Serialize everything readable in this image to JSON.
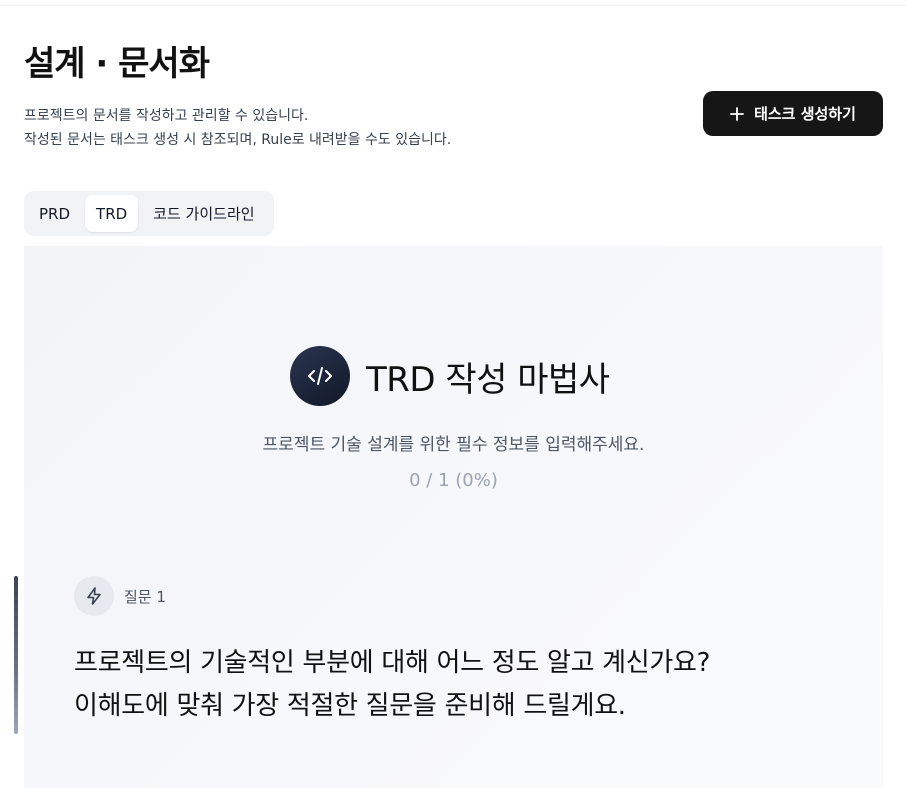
{
  "header": {
    "title": "설계 · 문서화",
    "description_line1": "프로젝트의 문서를 작성하고 관리할 수 있습니다.",
    "description_line2": "작성된 문서는 태스크 생성 시 참조되며, Rule로 내려받을 수도 있습니다.",
    "create_task_label": "태스크 생성하기"
  },
  "tabs": [
    {
      "label": "PRD",
      "active": false
    },
    {
      "label": "TRD",
      "active": true
    },
    {
      "label": "코드 가이드라인",
      "active": false
    }
  ],
  "wizard": {
    "title": "TRD 작성 마법사",
    "subtitle": "프로젝트 기술 설계를 위한 필수 정보를 입력해주세요.",
    "progress": "0 / 1 (0%)",
    "question_label": "질문 1",
    "question_line1": "프로젝트의 기술적인 부분에 대해 어느 정도 알고 계신가요?",
    "question_line2": "이해도에 맞춰 가장 적절한 질문을 준비해 드릴게요."
  },
  "icons": {
    "create_button": "plus-icon",
    "wizard_badge": "code-icon",
    "question_badge": "lightning-icon"
  },
  "colors": {
    "primary_button": "#161616",
    "badge": "#1a2233",
    "progress_text": "#9aa3b2"
  }
}
